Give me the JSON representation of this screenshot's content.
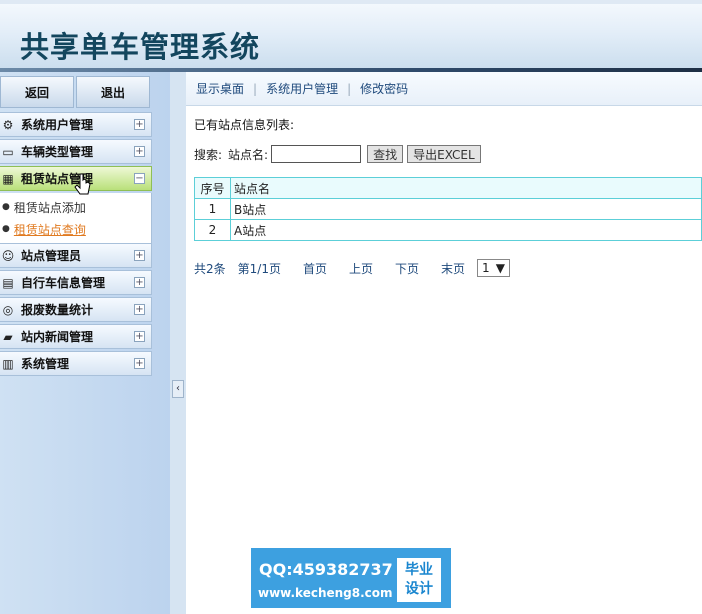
{
  "app": {
    "title": "共享单车管理系统"
  },
  "sidebar": {
    "back_label": "返回",
    "exit_label": "退出",
    "items": [
      {
        "label": "系统用户管理",
        "icon": "gear-icon"
      },
      {
        "label": "车辆类型管理",
        "icon": "monitor-icon"
      },
      {
        "label": "租赁站点管理",
        "icon": "table-icon",
        "expanded": true,
        "sub": [
          {
            "label": "租赁站点添加"
          },
          {
            "label": "租赁站点查询",
            "current": true
          }
        ]
      },
      {
        "label": "站点管理员",
        "icon": "user-icon"
      },
      {
        "label": "自行车信息管理",
        "icon": "calendar-icon"
      },
      {
        "label": "报废数量统计",
        "icon": "coins-icon"
      },
      {
        "label": "站内新闻管理",
        "icon": "folder-icon"
      },
      {
        "label": "系统管理",
        "icon": "chart-icon"
      }
    ],
    "toggle_plus": "+",
    "toggle_minus": "−",
    "collapse_arrow": "‹"
  },
  "topnav": {
    "links": [
      "显示桌面",
      "系统用户管理",
      "修改密码"
    ],
    "separator": "|"
  },
  "main": {
    "list_title": "已有站点信息列表:",
    "search": {
      "prefix": "搜索:",
      "field_label": "站点名:",
      "value": "",
      "find_label": "查找",
      "export_label": "导出EXCEL"
    },
    "table": {
      "headers": [
        "序号",
        "站点名"
      ],
      "rows": [
        [
          "1",
          "B站点"
        ],
        [
          "2",
          "A站点"
        ]
      ]
    },
    "pager": {
      "count": "共2条",
      "page_info": "第1/1页",
      "first": "首页",
      "prev": "上页",
      "next": "下页",
      "last": "末页",
      "page_select": "1"
    }
  },
  "watermark": {
    "qq": "QQ:459382737",
    "url": "www.kecheng8.com",
    "badge_line1": "毕业",
    "badge_line2": "设计"
  }
}
